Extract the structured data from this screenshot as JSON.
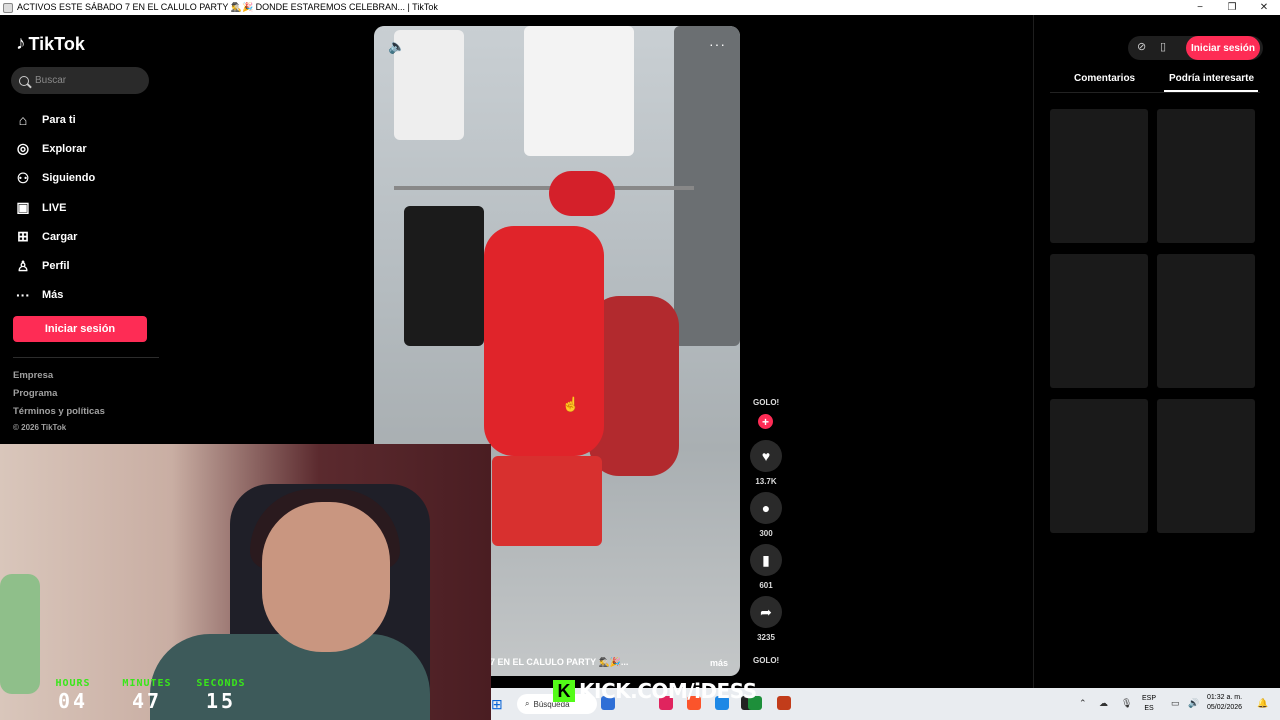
{
  "window": {
    "title": "ACTIVOS ESTE SÁBADO 7 EN EL CALULO PARTY 🕵️‍♂️🎉 DONDE ESTAREMOS CELEBRAN... | TikTok",
    "minimize": "−",
    "maximize": "❐",
    "close": "✕"
  },
  "sidebar": {
    "logo_text": "TikTok",
    "search_placeholder": "Buscar",
    "nav": [
      {
        "label": "Para ti",
        "icon": "home-icon"
      },
      {
        "label": "Explorar",
        "icon": "compass-icon"
      },
      {
        "label": "Siguiendo",
        "icon": "following-icon"
      },
      {
        "label": "LIVE",
        "icon": "live-icon"
      },
      {
        "label": "Cargar",
        "icon": "upload-icon"
      },
      {
        "label": "Perfil",
        "icon": "profile-icon"
      },
      {
        "label": "Más",
        "icon": "more-icon"
      }
    ],
    "login_label": "Iniciar sesión",
    "footer": [
      "Empresa",
      "Programa",
      "Términos y políticas"
    ],
    "copyright": "© 2026 TikTok"
  },
  "video": {
    "caption": "7 EN EL CALULO PARTY 🕵️‍♂️🎉...",
    "more_label": "más"
  },
  "actions": {
    "author": "GOLO!",
    "likes": "13.7K",
    "comments": "300",
    "saves": "601",
    "shares": "3235"
  },
  "right_panel": {
    "login_label": "Iniciar sesión",
    "tabs": [
      "Comentarios",
      "Podría interesarte"
    ]
  },
  "webcam": {
    "timer": [
      {
        "label": "HOURS",
        "value": "04"
      },
      {
        "label": "MINUTES",
        "value": "47"
      },
      {
        "label": "SECONDS",
        "value": "15"
      }
    ]
  },
  "kick": {
    "logo": "K",
    "text": "KICK.COM/iDESS"
  },
  "taskbar": {
    "search_label": "Búsqueda",
    "lang_top": "ESP",
    "lang_bottom": "ES",
    "time": "01:32 a. m.",
    "date": "05/02/2026"
  },
  "colors": {
    "brand": "#fe2c55",
    "kick": "#53fc18",
    "timer_label": "#39e61a"
  }
}
